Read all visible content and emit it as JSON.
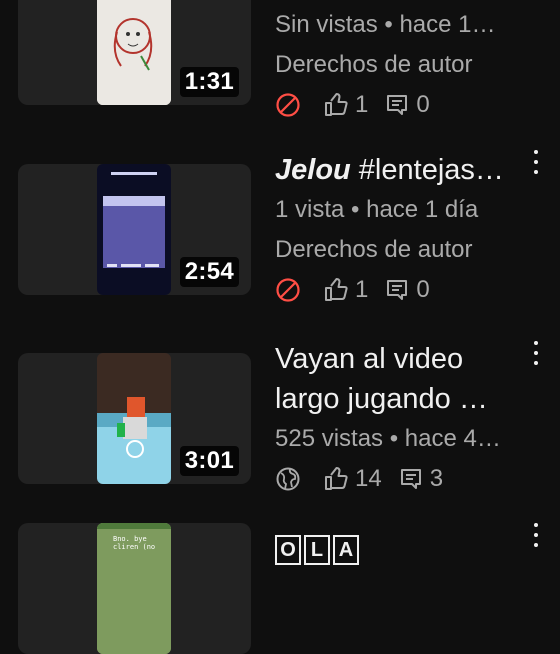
{
  "videos": [
    {
      "title": "",
      "views_age": "Sin vistas • hace 1…",
      "copyright": "Derechos de autor",
      "duration": "1:31",
      "visibility_icon": "blocked-icon",
      "likes": "1",
      "comments": "0"
    },
    {
      "title_bold": "Jelou",
      "title_rest": " #lentejas…",
      "views_age": "1 vista • hace 1 día",
      "copyright": "Derechos de autor",
      "duration": "2:54",
      "visibility_icon": "blocked-icon",
      "likes": "1",
      "comments": "0"
    },
    {
      "title": "Vayan al video largo jugando …",
      "views_age": "525 vistas • hace 4…",
      "duration": "3:01",
      "visibility_icon": "globe-icon",
      "likes": "14",
      "comments": "3"
    },
    {
      "title_letters": [
        "O",
        "L",
        "A"
      ],
      "thumb_text": "Bno. bye cliren (no"
    }
  ],
  "colors": {
    "background": "#0f0f0f",
    "text": "#f1f1f1",
    "secondary": "#aaaaaa",
    "blocked": "#ff4e45"
  }
}
